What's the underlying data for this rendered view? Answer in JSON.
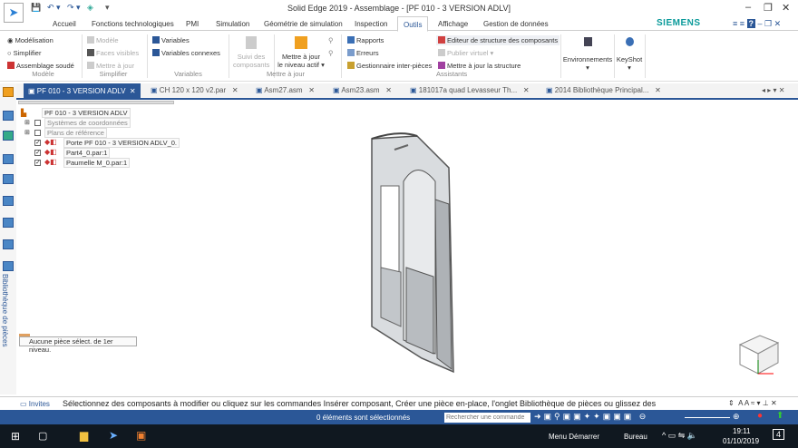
{
  "title": "Solid Edge 2019 - Assemblage - [PF 010 - 3 VERSION ADLV]",
  "brand": "SIEMENS",
  "tabs": [
    "Accueil",
    "Fonctions technologiques",
    "PMI",
    "Simulation",
    "Géométrie de simulation",
    "Inspection",
    "Outils",
    "Affichage",
    "Gestion de données"
  ],
  "active_tab": "Outils",
  "ribbon": {
    "modele": {
      "items": [
        "Modélisation",
        "Simplifier",
        "Assemblage soudé"
      ],
      "label": "Modèle"
    },
    "simplifier": {
      "items": [
        "Modèle",
        "Faces visibles",
        "Mettre à jour"
      ],
      "label": "Simplifier"
    },
    "variables": {
      "items": [
        "Variables",
        "Variables connexes"
      ],
      "label": "Variables"
    },
    "maj": {
      "suivi": [
        "Suivi des",
        "composants"
      ],
      "niveau": [
        "Mettre à jour",
        "le niveau actif ▾"
      ],
      "label": "Mettre à jour"
    },
    "assistants": {
      "items": [
        "Rapports",
        "Erreurs",
        "Gestionnaire inter-pièces",
        "Editeur de structure des composants",
        "Publier virtuel ▾",
        "Mettre à jour la structure"
      ],
      "label": "Assistants"
    },
    "environnements": "Environnements",
    "keyshot": "KeyShot"
  },
  "doc_tabs": [
    "PF 010 - 3 VERSION ADLV",
    "CH 120 x 120 v2.par",
    "Asm27.asm",
    "Asm23.asm",
    "181017a quad Levasseur Th...",
    "2014 Bibliothèque Principal..."
  ],
  "tree": [
    "PF 010 - 3 VERSION ADLV",
    "Systèmes de coordonnées",
    "Plans de référence",
    "Porte PF 010 - 3 VERSION ADLV_0.",
    "Part4_0.par:1",
    "Paumelle M_0.par:1"
  ],
  "side_label": "Bibliothèque de pièces",
  "tooltip": "Aucune pièce sélect. de 1er niveau.",
  "prompt": {
    "label": "Invites",
    "text": "Sélectionnez des composants à modifier ou cliquez sur les commandes Insérer composant, Créer une pièce en-place, l'onglet Bibliothèque de pièces ou glissez des"
  },
  "status": {
    "selection": "0 éléments sont sélectionnés",
    "search_placeholder": "Rechercher une commande"
  },
  "taskbar": {
    "menu": "Menu Démarrer",
    "bureau": "Bureau",
    "time": "19:11",
    "date": "01/10/2019",
    "notif": "4"
  },
  "colors": {
    "accent": "#2b5797",
    "siemens": "#0a9a9a"
  }
}
